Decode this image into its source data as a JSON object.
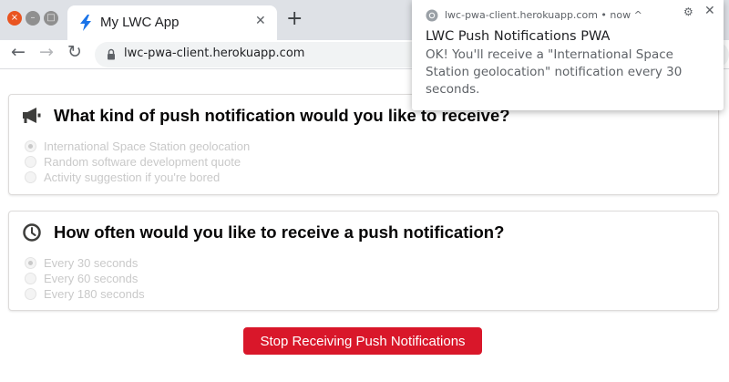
{
  "window": {
    "close_glyph": "×",
    "minimize_glyph": "–",
    "maximize_glyph": "□"
  },
  "tab": {
    "title": "My LWC App",
    "favicon": "lightning-bolt-icon",
    "close_glyph": "✕",
    "new_tab_glyph": "+"
  },
  "toolbar": {
    "back_glyph": "←",
    "forward_glyph": "→",
    "reload_glyph": "↻",
    "url": "lwc-pwa-client.herokuapp.com"
  },
  "cards": [
    {
      "icon": "megaphone-icon",
      "title": "What kind of push notification would you like to receive?",
      "options": [
        {
          "label": "International Space Station geolocation",
          "checked": true
        },
        {
          "label": "Random software development quote",
          "checked": false
        },
        {
          "label": "Activity suggestion if you're bored",
          "checked": false
        }
      ]
    },
    {
      "icon": "clock-icon",
      "title": "How often would you like to receive a push notification?",
      "options": [
        {
          "label": "Every 30 seconds",
          "checked": true
        },
        {
          "label": "Every 60 seconds",
          "checked": false
        },
        {
          "label": "Every 180 seconds",
          "checked": false
        }
      ]
    }
  ],
  "stop_button": {
    "label": "Stop Receiving Push Notifications"
  },
  "notification": {
    "source": "lwc-pwa-client.herokuapp.com • now ^",
    "title": "LWC Push Notifications PWA",
    "body": "OK! You'll receive a \"International Space Station geolocation\" notification every 30 seconds.",
    "settings_glyph": "⚙",
    "close_glyph": "✕"
  },
  "colors": {
    "brand_button": "#d9172a",
    "chrome_bar": "#dee1e6",
    "window_close": "#e95420"
  }
}
